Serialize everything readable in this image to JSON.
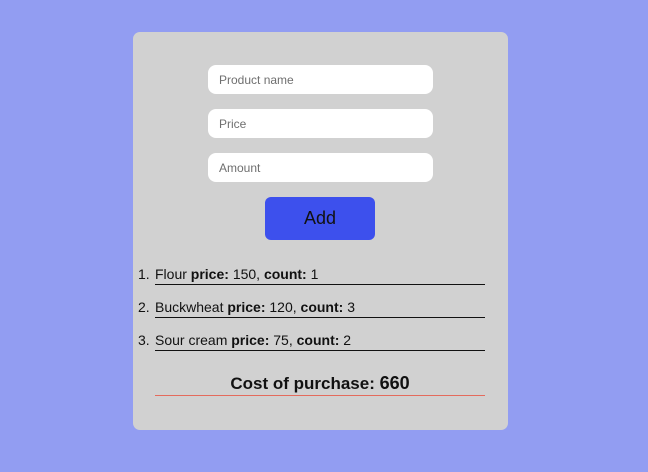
{
  "form": {
    "name_placeholder": "Product name",
    "price_placeholder": "Price",
    "amount_placeholder": "Amount",
    "add_label": "Add"
  },
  "labels": {
    "price": "price:",
    "count": "count:",
    "sep": ","
  },
  "items": [
    {
      "num": "1.",
      "name": "Flour",
      "price": "150",
      "count": "1"
    },
    {
      "num": "2.",
      "name": "Buckwheat",
      "price": "120",
      "count": "3"
    },
    {
      "num": "3.",
      "name": "Sour cream",
      "price": "75",
      "count": "2"
    }
  ],
  "total": {
    "label": "Cost of purchase:",
    "value": "660"
  },
  "colors": {
    "background": "#929df2",
    "card": "#d1d1d1",
    "button": "#3d50ed",
    "total_underline": "#e46b5d"
  }
}
